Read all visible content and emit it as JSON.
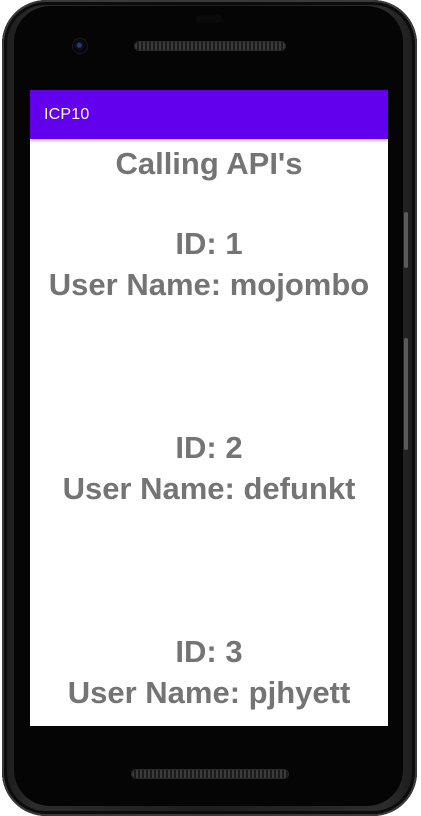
{
  "app": {
    "title": "ICP10"
  },
  "main": {
    "heading": "Calling API's",
    "users": [
      {
        "id_text": "ID: 1",
        "name_text": "User Name: mojombo"
      },
      {
        "id_text": "ID: 2",
        "name_text": "User Name: defunkt"
      },
      {
        "id_text": "ID: 3",
        "name_text": "User Name: pjhyett"
      }
    ]
  },
  "colors": {
    "app_bar": "#6200ee",
    "text": "#747474",
    "background": "#ffffff"
  }
}
